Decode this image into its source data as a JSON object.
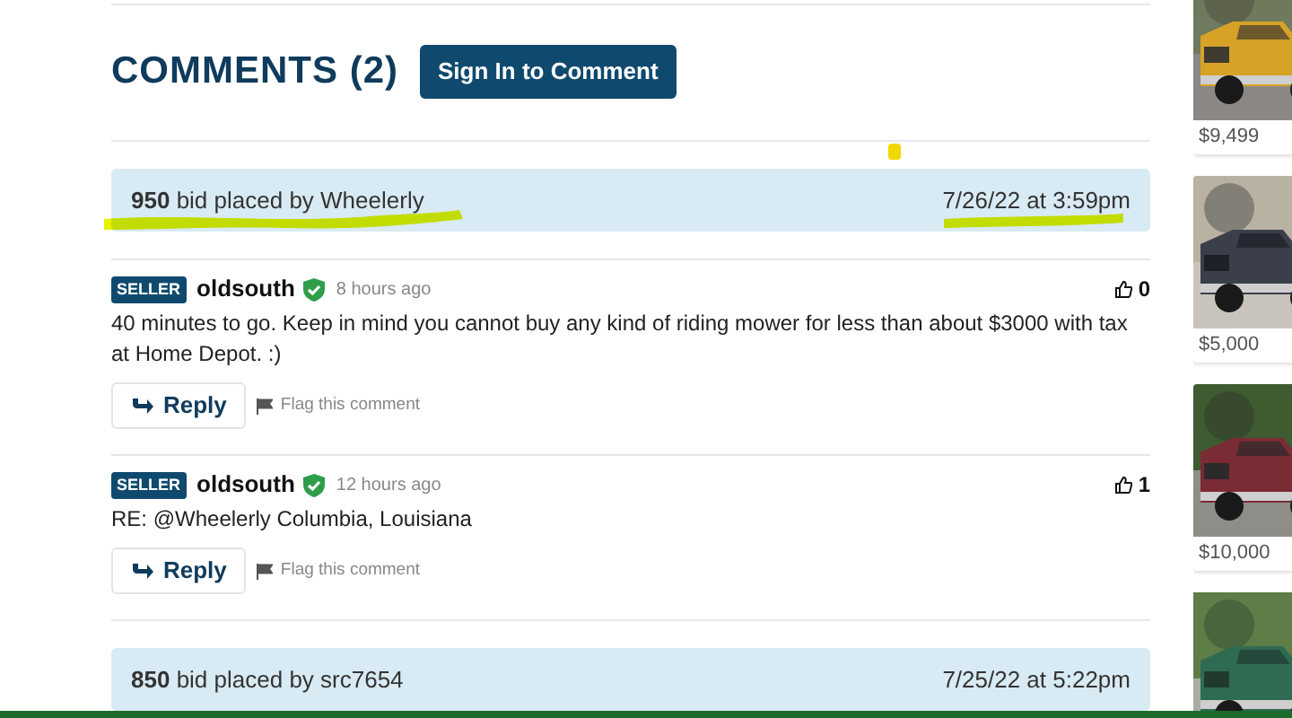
{
  "heading": "COMMENTS (2)",
  "sign_in_button": "Sign In to Comment",
  "feed": [
    {
      "kind": "bid",
      "text": "**950** bid placed by Wheelerly",
      "time": "7/26/22 at 3:59pm"
    },
    {
      "kind": "comment",
      "badge": "SELLER",
      "user": "oldsouth",
      "verified": true,
      "age": "8 hours ago",
      "likes": "0",
      "body": "40 minutes to go. Keep in mind you cannot buy any kind of riding mower for less than about $3000 with tax at Home Depot. :)",
      "reply": "Reply",
      "flag": "Flag this comment"
    },
    {
      "kind": "comment",
      "badge": "SELLER",
      "user": "oldsouth",
      "verified": true,
      "age": "12 hours ago",
      "likes": "1",
      "body": "RE: @Wheelerly Columbia, Louisiana",
      "reply": "Reply",
      "flag": "Flag this comment"
    },
    {
      "kind": "bid",
      "text": "**850** bid placed by src7654",
      "time": "7/25/22 at 5:22pm"
    }
  ],
  "listings": [
    {
      "price": "$9,499"
    },
    {
      "price": "$5,000"
    },
    {
      "price": "$10,000"
    },
    {
      "kind": "picture"
    }
  ]
}
